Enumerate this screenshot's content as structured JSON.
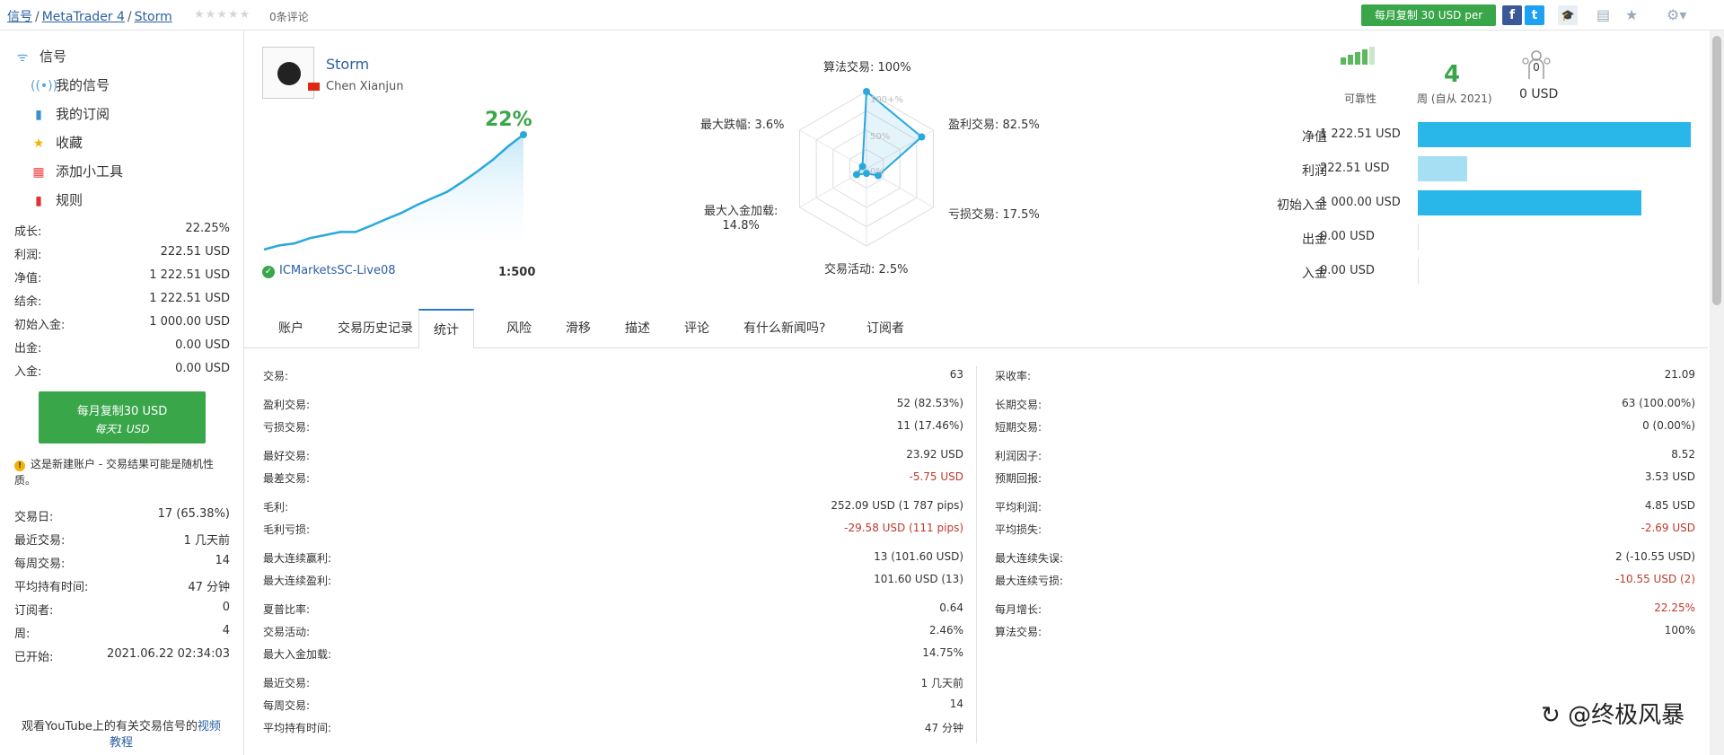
{
  "breadcrumb": {
    "signals": "信号",
    "platform": "MetaTrader 4",
    "name": "Storm"
  },
  "reviews": "0条评论",
  "top_copy_button": "每月复制 30 USD per",
  "sidebar": {
    "nav": [
      {
        "label": "信号",
        "icon": "signal-icon"
      },
      {
        "label": "我的信号",
        "icon": "broadcast-icon"
      },
      {
        "label": "我的订阅",
        "icon": "phone-icon"
      },
      {
        "label": "收藏",
        "icon": "star-icon"
      },
      {
        "label": "添加小工具",
        "icon": "widgets-icon"
      },
      {
        "label": "规则",
        "icon": "bookmark-icon"
      }
    ],
    "summary": [
      {
        "k": "成长:",
        "v": "22.25%"
      },
      {
        "k": "利润:",
        "v": "222.51 USD"
      },
      {
        "k": "净值:",
        "v": "1 222.51 USD"
      },
      {
        "k": "结余:",
        "v": "1 222.51 USD"
      },
      {
        "k": "初始入金:",
        "v": "1 000.00 USD"
      },
      {
        "k": "出金:",
        "v": "0.00 USD"
      },
      {
        "k": "入金:",
        "v": "0.00 USD"
      }
    ],
    "copy_line1": "每月复制30 USD",
    "copy_line2": "每天1 USD",
    "warning": "这是新建账户 - 交易结果可能是随机性质。",
    "details": [
      {
        "k": "交易日:",
        "v": "17 (65.38%)"
      },
      {
        "k": "最近交易:",
        "v": "1 几天前"
      },
      {
        "k": "每周交易:",
        "v": "14"
      },
      {
        "k": "平均持有时间:",
        "v": "47 分钟"
      },
      {
        "k": "订阅者:",
        "v": "0"
      },
      {
        "k": "周:",
        "v": "4"
      },
      {
        "k": "已开始:",
        "v": "2021.06.22 02:34:03"
      }
    ],
    "youtube_text": "观看YouTube上的有关交易信号的",
    "youtube_link": "视频教程"
  },
  "profile": {
    "name": "Storm",
    "author": "Chen Xianjun",
    "growth": "22%",
    "broker": "ICMarketsSC-Live08",
    "leverage": "1:500"
  },
  "growth_curve": [
    0,
    0.8,
    1.2,
    2.2,
    2.8,
    3.4,
    3.4,
    4.6,
    5.9,
    7.1,
    8.6,
    9.9,
    11.2,
    13.1,
    15.2,
    17.4,
    20.0,
    22.25
  ],
  "radar": {
    "labels": [
      {
        "text": "算法交易: 100%",
        "value": 100
      },
      {
        "text": "盈利交易: 82.5%",
        "value": 82.5
      },
      {
        "text": "亏损交易: 17.5%",
        "value": 17.5
      },
      {
        "text": "交易活动: 2.5%",
        "value": 2.5
      },
      {
        "text": "最大入金加载:\n14.8%",
        "value": 14.8
      },
      {
        "text": "最大跌幅: 3.6%",
        "value": 3.6
      }
    ],
    "ticks": [
      "100+%",
      "50%",
      "0%"
    ]
  },
  "right": {
    "reliability_label": "可靠性",
    "weeks": "4",
    "weeks_label": "周 (自从 2021)",
    "subscribers_count": "0",
    "subscribers_value": "0 USD",
    "bars": [
      {
        "k": "净值",
        "v": "1 222.51 USD",
        "amount": 1222.51,
        "style": "dark"
      },
      {
        "k": "利润",
        "v": "222.51 USD",
        "amount": 222.51,
        "style": "light"
      },
      {
        "k": "初始入金",
        "v": "1 000.00 USD",
        "amount": 1000.0,
        "style": "dark"
      },
      {
        "k": "出金",
        "v": "0.00 USD",
        "amount": 0,
        "style": "dark"
      },
      {
        "k": "入金",
        "v": "0.00 USD",
        "amount": 0,
        "style": "dark"
      }
    ]
  },
  "tabs": [
    "账户",
    "交易历史记录",
    "统计",
    "风险",
    "滑移",
    "描述",
    "评论",
    "有什么新闻吗?",
    "订阅者"
  ],
  "active_tab": "统计",
  "stats_left": [
    [
      {
        "k": "交易:",
        "v": "63"
      }
    ],
    [
      {
        "k": "盈利交易:",
        "v": "52 (82.53%)"
      },
      {
        "k": "亏损交易:",
        "v": "11 (17.46%)"
      }
    ],
    [
      {
        "k": "最好交易:",
        "v": "23.92 USD"
      },
      {
        "k": "最差交易:",
        "v": "-5.75 USD",
        "neg": true
      }
    ],
    [
      {
        "k": "毛利:",
        "v": "252.09 USD (1 787 pips)"
      },
      {
        "k": "毛利亏损:",
        "v": "-29.58 USD (111 pips)",
        "neg": true
      }
    ],
    [
      {
        "k": "最大连续赢利:",
        "v": "13 (101.60 USD)"
      },
      {
        "k": "最大连续盈利:",
        "v": "101.60 USD (13)"
      }
    ],
    [
      {
        "k": "夏普比率:",
        "v": "0.64"
      },
      {
        "k": "交易活动:",
        "v": "2.46%"
      },
      {
        "k": "最大入金加载:",
        "v": "14.75%"
      }
    ],
    [
      {
        "k": "最近交易:",
        "v": "1 几天前"
      },
      {
        "k": "每周交易:",
        "v": "14"
      },
      {
        "k": "平均持有时间:",
        "v": "47 分钟"
      }
    ]
  ],
  "stats_right": [
    [
      {
        "k": "采收率:",
        "v": "21.09"
      }
    ],
    [
      {
        "k": "长期交易:",
        "v": "63 (100.00%)"
      },
      {
        "k": "短期交易:",
        "v": "0 (0.00%)"
      }
    ],
    [
      {
        "k": "利润因子:",
        "v": "8.52"
      },
      {
        "k": "预期回报:",
        "v": "3.53 USD"
      }
    ],
    [
      {
        "k": "平均利润:",
        "v": "4.85 USD"
      },
      {
        "k": "平均损失:",
        "v": "-2.69 USD",
        "neg": true
      }
    ],
    [
      {
        "k": "最大连续失误:",
        "v": "2 (-10.55 USD)"
      },
      {
        "k": "最大连续亏损:",
        "v": "-10.55 USD (2)",
        "neg": true
      }
    ],
    [
      {
        "k": "每月增长:",
        "v": "22.25%",
        "pos": true
      },
      {
        "k": "算法交易:",
        "v": "100%"
      }
    ]
  ],
  "watermark": "@终极风暴",
  "colors": {
    "accent_green": "#3aa64a",
    "bar_blue": "#29b6e8",
    "link": "#2a5f9e",
    "negative": "#c0392b"
  }
}
